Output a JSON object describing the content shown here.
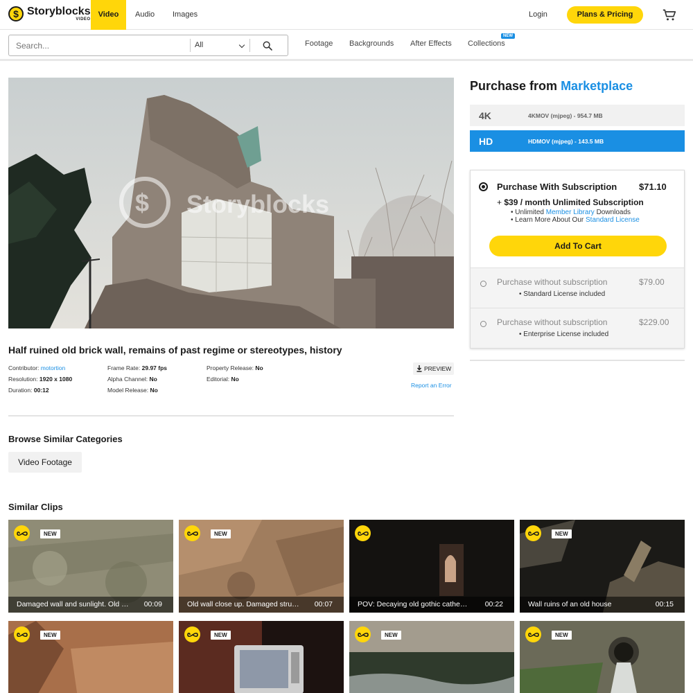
{
  "brand": {
    "name": "Storyblocks",
    "sub": "VIDEO"
  },
  "nav": {
    "tabs": [
      "Video",
      "Audio",
      "Images"
    ],
    "login": "Login",
    "plans": "Plans & Pricing"
  },
  "search": {
    "placeholder": "Search...",
    "scope": "All",
    "links": [
      "Footage",
      "Backgrounds",
      "After Effects",
      "Collections"
    ],
    "new_badge": "NEW"
  },
  "clip": {
    "watermark": "Storyblocks",
    "title": "Half ruined old brick wall, remains of past regime or stereotypes, history",
    "meta": {
      "contributor_label": "Contributor:",
      "contributor": "motortion",
      "resolution_label": "Resolution:",
      "resolution": "1920 x 1080",
      "duration_label": "Duration:",
      "duration": "00:12",
      "framerate_label": "Frame Rate:",
      "framerate": "29.97 fps",
      "alpha_label": "Alpha Channel:",
      "alpha": "No",
      "model_label": "Model Release:",
      "model": "No",
      "property_label": "Property Release:",
      "property": "No",
      "editorial_label": "Editorial:",
      "editorial": "No"
    },
    "preview": "PREVIEW",
    "report": "Report an Error"
  },
  "browse": {
    "title": "Browse Similar Categories",
    "chip": "Video Footage"
  },
  "purchase": {
    "title_a": "Purchase from",
    "title_b": "Marketplace",
    "formats": [
      {
        "res": "4K",
        "desc": "4KMOV (mjpeg) - 954.7 MB"
      },
      {
        "res": "HD",
        "desc": "HDMOV (mjpeg) - 143.5 MB"
      }
    ],
    "sub": {
      "title": "Purchase With Subscription",
      "price": "$71.10",
      "line_plus": "+",
      "line_price": "$39",
      "line_rest": "/ month Unlimited Subscription",
      "b1_a": "Unlimited",
      "b1_link": "Member Library",
      "b1_b": "Downloads",
      "b2_a": "Learn More About Our",
      "b2_link": "Standard License",
      "cta": "Add To Cart"
    },
    "alt1": {
      "title": "Purchase without subscription",
      "price": "$79.00",
      "bullet": "Standard License included"
    },
    "alt2": {
      "title": "Purchase without subscription",
      "price": "$229.00",
      "bullet": "Enterprise License included"
    }
  },
  "similar": {
    "title": "Similar Clips",
    "new_label": "NEW",
    "clips": [
      {
        "title": "Damaged wall and sunlight. Old stone wall",
        "duration": "00:09"
      },
      {
        "title": "Old wall close up. Damaged structure",
        "duration": "00:07"
      },
      {
        "title": "POV: Decaying old gothic cathedral",
        "duration": "00:22"
      },
      {
        "title": "Wall ruins of an old house",
        "duration": "00:15"
      }
    ]
  },
  "colors": {
    "accent": "#ffd60a",
    "link": "#1a8fe3"
  }
}
